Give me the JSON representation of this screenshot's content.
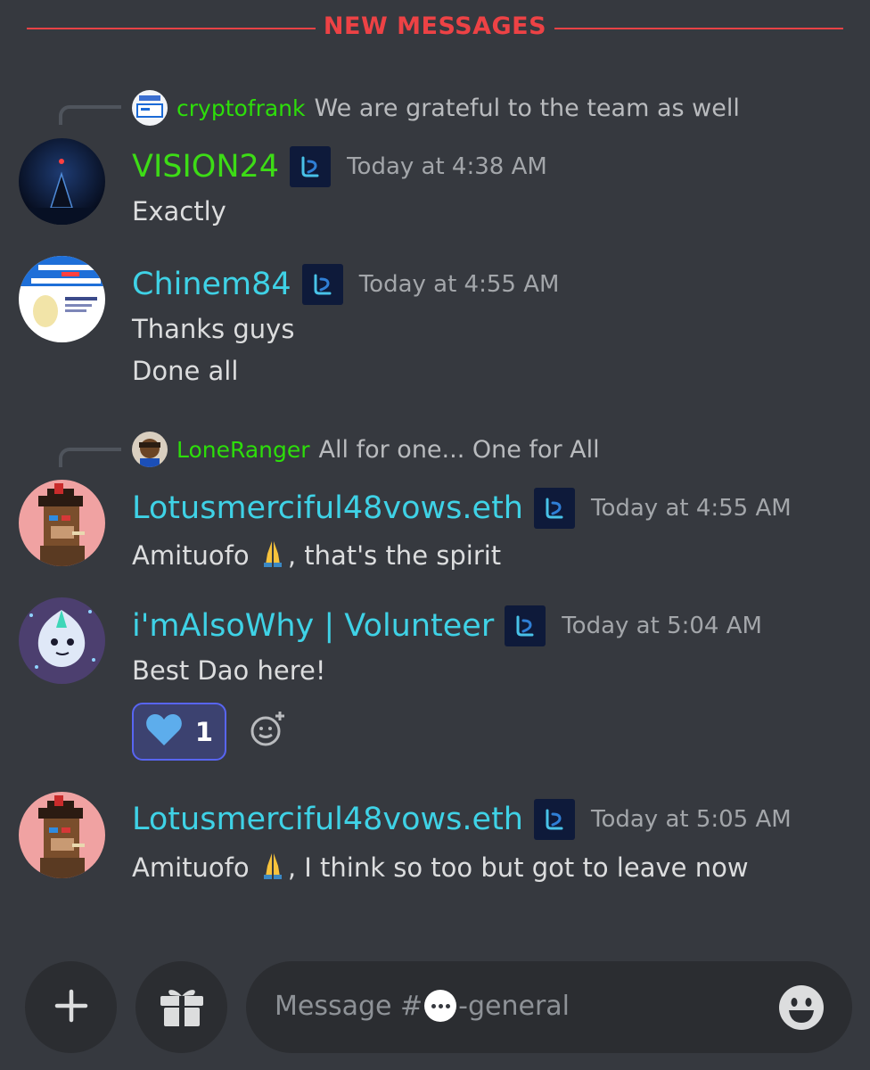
{
  "divider": {
    "label": "NEW MESSAGES",
    "color": "#ed4245"
  },
  "messages": [
    {
      "reply": {
        "username": "cryptofrank",
        "text": "We are grateful to the team as well"
      },
      "username": "VISION24",
      "username_color": "#3ddc16",
      "timestamp": "Today at 4:38 AM",
      "lines": [
        "Exactly"
      ]
    },
    {
      "username": "Chinem84",
      "username_color": "#3fd2e6",
      "timestamp": "Today at 4:55 AM",
      "lines": [
        "Thanks guys",
        "Done all"
      ]
    },
    {
      "reply": {
        "username": "LoneRanger",
        "text": "All for one... One for All"
      },
      "username": "Lotusmerciful48vows.eth",
      "username_color": "#3fd2e6",
      "timestamp": "Today at 4:55 AM",
      "lines": [
        {
          "before": "Amituofo ",
          "emoji": "folded-hands",
          "after": ", that's the spirit"
        }
      ]
    },
    {
      "username": "i'mAlsoWhy | Volunteer",
      "username_color": "#3fd2e6",
      "timestamp": "Today at 5:04 AM",
      "lines": [
        "Best Dao here!"
      ],
      "reactions": [
        {
          "emoji": "blue-heart",
          "count": "1",
          "active": true
        }
      ]
    },
    {
      "username": "Lotusmerciful48vows.eth",
      "username_color": "#3fd2e6",
      "timestamp": "Today at 5:05 AM",
      "lines": [
        {
          "before": "Amituofo ",
          "emoji": "folded-hands",
          "after": ", I think so too but got to leave now"
        }
      ]
    }
  ],
  "composer": {
    "placeholder_prefix": "Message #",
    "channel_emoji": "speech-bubble",
    "placeholder_suffix": "-general"
  },
  "icons": {
    "add": "plus-icon",
    "gift": "gift-icon",
    "emoji_picker": "smiley-icon",
    "add_reaction": "add-reaction-icon",
    "role": "role-badge-icon"
  }
}
